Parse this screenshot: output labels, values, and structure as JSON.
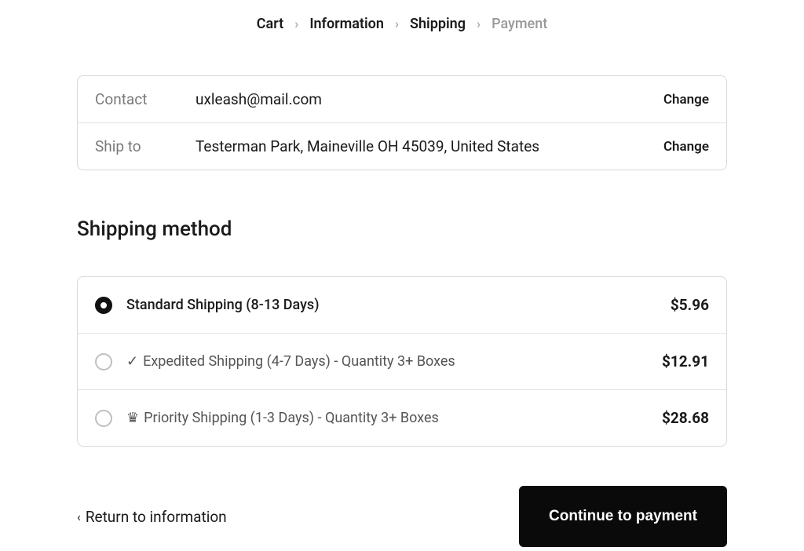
{
  "breadcrumb": {
    "items": [
      {
        "label": "Cart",
        "active": true
      },
      {
        "label": "Information",
        "active": true
      },
      {
        "label": "Shipping",
        "active": true
      },
      {
        "label": "Payment",
        "active": false
      }
    ]
  },
  "info": {
    "contact": {
      "label": "Contact",
      "value": "uxleash@mail.com",
      "change_label": "Change"
    },
    "ship_to": {
      "label": "Ship to",
      "value": "Testerman Park, Maineville OH 45039, United States",
      "change_label": "Change"
    }
  },
  "section_title": "Shipping method",
  "shipping_options": [
    {
      "icon": "",
      "label": "Standard Shipping (8-13 Days)",
      "price": "$5.96",
      "selected": true
    },
    {
      "icon": "✓",
      "label": "Expedited Shipping (4-7 Days) - Quantity 3+ Boxes",
      "price": "$12.91",
      "selected": false
    },
    {
      "icon": "♛",
      "label": "Priority Shipping (1-3 Days) - Quantity 3+ Boxes",
      "price": "$28.68",
      "selected": false
    }
  ],
  "footer": {
    "return_label": "Return to information",
    "continue_label": "Continue to payment"
  }
}
